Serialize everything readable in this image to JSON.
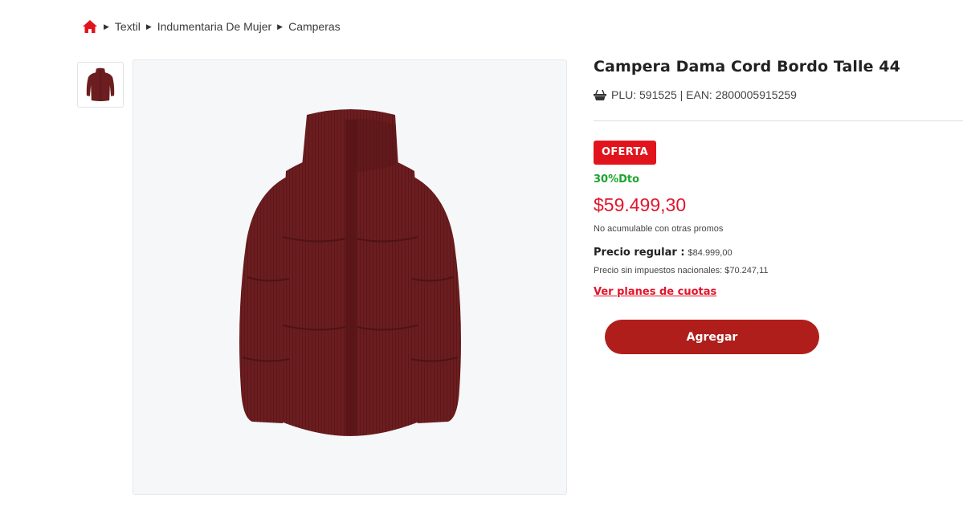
{
  "breadcrumb": {
    "items": [
      "Textil",
      "Indumentaria De Mujer",
      "Camperas"
    ]
  },
  "product": {
    "title": "Campera Dama Cord Bordo Talle 44",
    "codes": "PLU: 591525 | EAN: 2800005915259",
    "badge": "OFERTA",
    "discount": "30%Dto",
    "price": "$59.499,30",
    "no_acumulable": "No acumulable con otras promos",
    "regular_label": "Precio regular :",
    "regular_value": "$84.999,00",
    "sin_impuestos": "Precio sin impuestos nacionales: $70.247,11",
    "cuotas_link": "Ver planes de cuotas",
    "add_button": "Agregar"
  },
  "icons": {
    "home": "home-icon",
    "basket": "basket-icon",
    "separator": "caret-right-icon"
  },
  "colors": {
    "accent_red": "#e2152b",
    "badge_red": "#e1141e",
    "button_red": "#b01e1b",
    "discount_green": "#1aa52c",
    "jacket": "#6b1d1f"
  }
}
